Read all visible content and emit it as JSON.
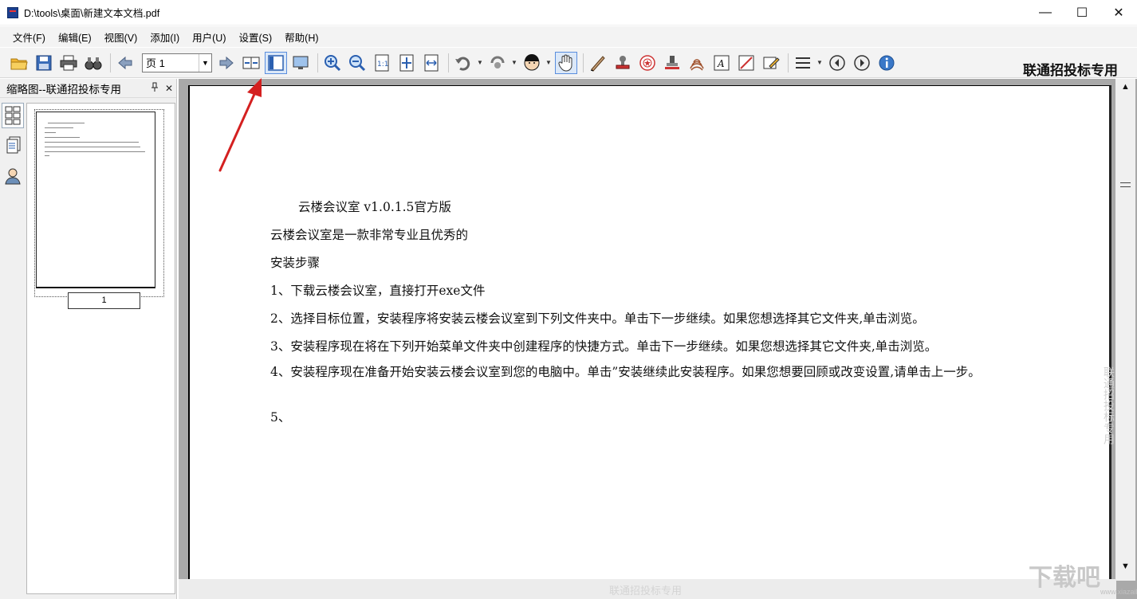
{
  "window": {
    "title": "D:\\tools\\桌面\\新建文本文档.pdf",
    "minimize": "—",
    "maximize": "☐",
    "close": "✕"
  },
  "menu": [
    {
      "label": "文件(F)"
    },
    {
      "label": "编辑(E)"
    },
    {
      "label": "视图(V)"
    },
    {
      "label": "添加(I)"
    },
    {
      "label": "用户(U)"
    },
    {
      "label": "设置(S)"
    },
    {
      "label": "帮助(H)"
    }
  ],
  "toolbar": {
    "page_label": "页 1",
    "brand": "联通招投标专用"
  },
  "sidebar": {
    "title": "缩略图--联通招投标专用",
    "pin": "ᵖ",
    "close": "✕",
    "thumb_page_label": "1"
  },
  "document": {
    "lines": [
      "云楼会议室 v1.0.1.5官方版",
      "云楼会议室是一款非常专业且优秀的",
      "安装步骤",
      "1、下载云楼会议室，直接打开exe文件",
      "2、选择目标位置，安装程序将安装云楼会议室到下列文件夹中。单击下一步继续。如果您想选择其它文件夹,单击浏览。",
      "3、安装程序现在将在下列开始菜单文件夹中创建程序的快捷方式。单击下一步继续。如果您想选择其它文件夹,单击浏览。",
      "4、安装程序现在准备开始安装云楼会议室到您的电脑中。单击”安装继续此安装程序。如果您想要回顾或改变设置,请单击上一步。",
      "5、"
    ],
    "watermark_vertical": "联通招投标专用",
    "watermark_bottom": "联通招投标专用"
  },
  "corner": {
    "logo": "下载吧",
    "sub": "www.xiazaiba.com"
  }
}
